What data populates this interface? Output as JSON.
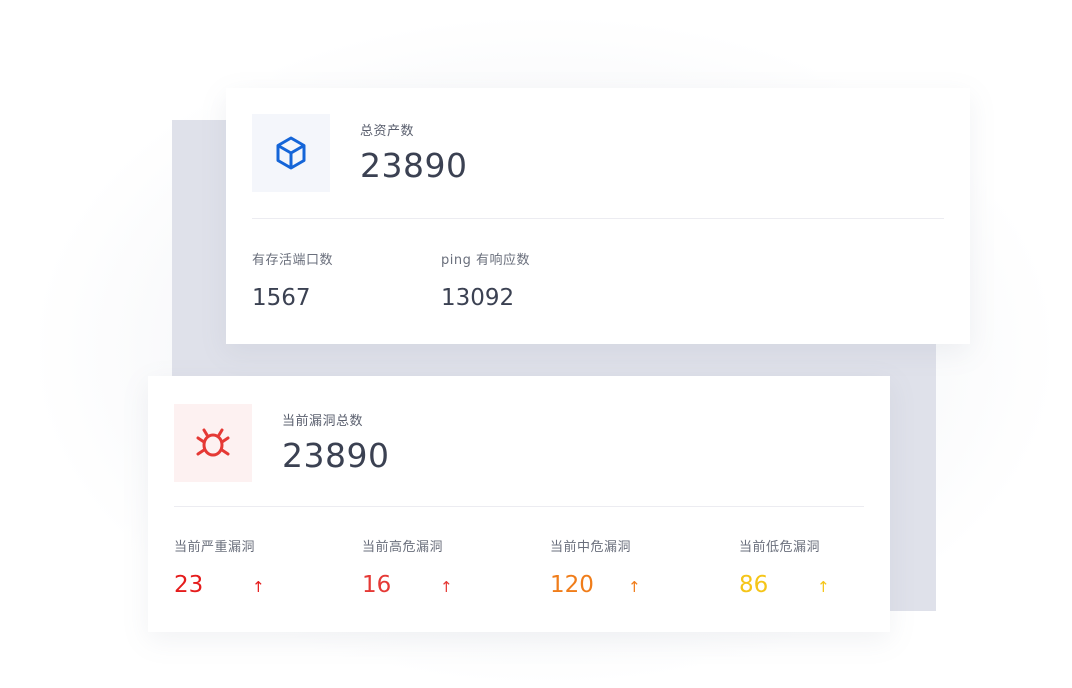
{
  "assets": {
    "icon": "cube-icon",
    "title": "总资产数",
    "total": "23890",
    "stats": [
      {
        "label": "有存活端口数",
        "value": "1567"
      },
      {
        "label": "ping 有响应数",
        "value": "13092"
      }
    ]
  },
  "vulnerabilities": {
    "icon": "bug-icon",
    "title": "当前漏洞总数",
    "total": "23890",
    "stats": [
      {
        "label": "当前严重漏洞",
        "value": "23",
        "trend": "↑",
        "color": "#e51c1c"
      },
      {
        "label": "当前高危漏洞",
        "value": "16",
        "trend": "↑",
        "color": "#e53935"
      },
      {
        "label": "当前中危漏洞",
        "value": "120",
        "trend": "↑",
        "color": "#f07d1a"
      },
      {
        "label": "当前低危漏洞",
        "value": "86",
        "trend": "↑",
        "color": "#f5c518"
      }
    ]
  },
  "colors": {
    "asset_icon": "#1565d8",
    "bug_icon": "#e53935"
  }
}
